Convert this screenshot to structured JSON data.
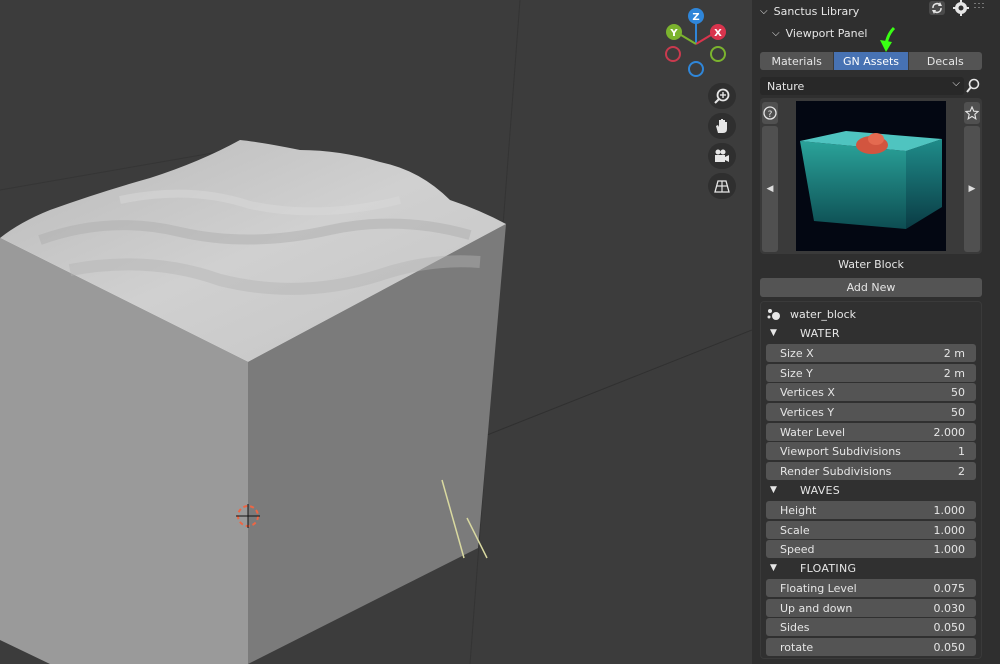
{
  "panel": {
    "title": "Sanctus Library",
    "subtitle": "Viewport Panel",
    "tabs": [
      "Materials",
      "GN Assets",
      "Decals"
    ],
    "active_tab": "GN Assets",
    "category": "Nature",
    "asset_name": "Water Block",
    "add_new_label": "Add New",
    "object_name": "water_block"
  },
  "sections": {
    "water": {
      "title": "WATER",
      "fields": [
        {
          "label": "Size X",
          "value": "2 m"
        },
        {
          "label": "Size Y",
          "value": "2 m"
        },
        {
          "label": "Vertices X",
          "value": "50"
        },
        {
          "label": "Vertices Y",
          "value": "50"
        },
        {
          "label": "Water Level",
          "value": "2.000"
        },
        {
          "label": "Viewport Subdivisions",
          "value": "1"
        },
        {
          "label": "Render Subdivisions",
          "value": "2"
        }
      ]
    },
    "waves": {
      "title": "WAVES",
      "fields": [
        {
          "label": "Height",
          "value": "1.000"
        },
        {
          "label": "Scale",
          "value": "1.000"
        },
        {
          "label": "Speed",
          "value": "1.000"
        }
      ]
    },
    "floating": {
      "title": "FLOATING",
      "fields": [
        {
          "label": "Floating Level",
          "value": "0.075"
        },
        {
          "label": "Up and down",
          "value": "0.030"
        },
        {
          "label": "Sides",
          "value": "0.050"
        },
        {
          "label": "rotate",
          "value": "0.050"
        }
      ]
    }
  },
  "gizmo": {
    "x": "X",
    "y": "Y",
    "z": "Z"
  },
  "icons": [
    "zoom-icon",
    "hand-pan-icon",
    "camera-icon",
    "grid-icon",
    "refresh-icon",
    "gear-icon",
    "search-icon",
    "help-icon",
    "star-icon",
    "chevron-left-icon",
    "chevron-right-icon",
    "object-icon"
  ],
  "colors": {
    "accent": "#4772b3",
    "arrow": "#39ff14",
    "x_axis": "#d9344d",
    "y_axis": "#7bb32e",
    "z_axis": "#2f86d9"
  }
}
